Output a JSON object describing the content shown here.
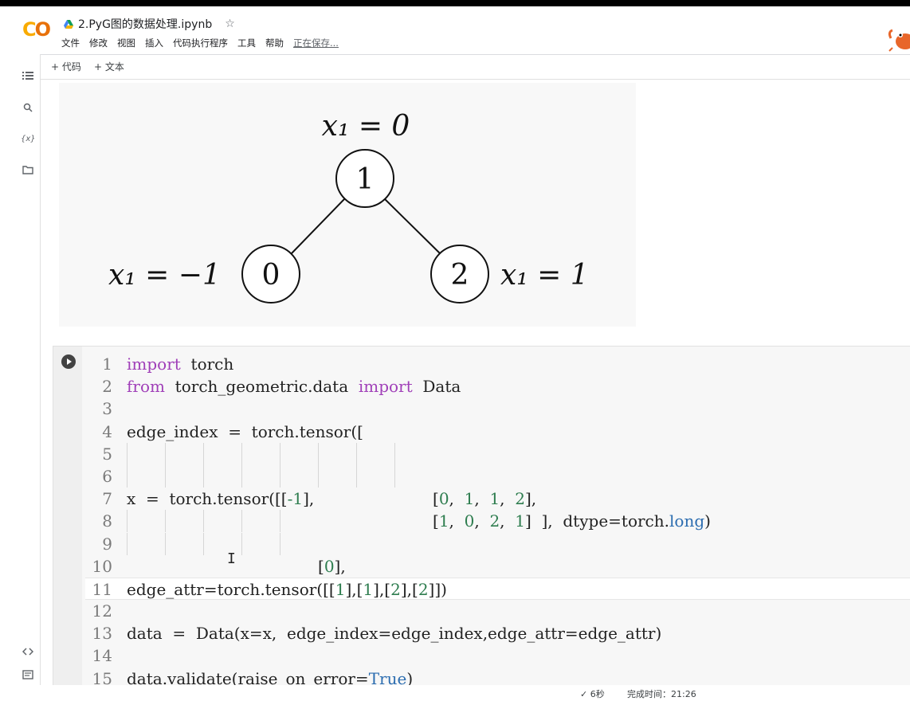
{
  "app": {
    "logo": "CO",
    "title": "2.PyG图的数据处理.ipynb",
    "menu": [
      "文件",
      "修改",
      "视图",
      "插入",
      "代码执行程序",
      "工具",
      "帮助"
    ],
    "saving_text": "正在保存..."
  },
  "toolbar": {
    "add_code": "+ 代码",
    "add_text": "+ 文本"
  },
  "sidebar": {
    "icons": [
      "toc-icon",
      "search-icon",
      "variables-icon",
      "folder-icon",
      "code-snippets-icon",
      "terminal-icon"
    ],
    "variables_glyph": "{x}"
  },
  "diagram": {
    "labels": {
      "top": "x₁ = 0",
      "left": "x₁ = −1",
      "right": "x₁ = 1"
    },
    "nodes": {
      "n1": "1",
      "n0": "0",
      "n2": "2"
    }
  },
  "code": {
    "line_numbers": [
      "1",
      "2",
      "3",
      "4",
      "5",
      "6",
      "7",
      "8",
      "9",
      "10",
      "11",
      "12",
      "13",
      "14",
      "15"
    ]
  },
  "status": {
    "check": "✓",
    "duration": "6秒",
    "completed": "完成时间：21:26"
  },
  "colors": {
    "keyword": "#a03fb8",
    "number": "#2e7d4f",
    "attribute": "#2c6db0"
  }
}
